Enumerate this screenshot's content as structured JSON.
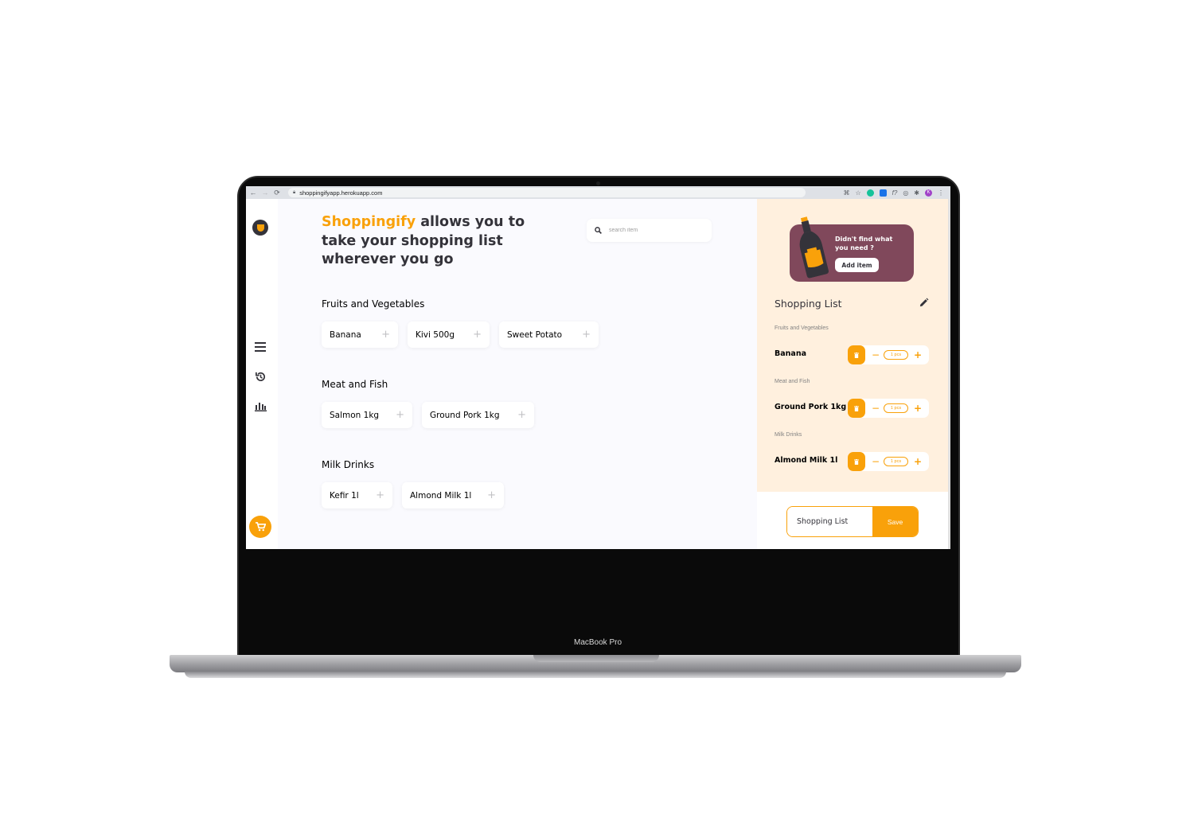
{
  "device": {
    "model_label": "MacBook Pro"
  },
  "browser": {
    "url": "shoppingifyapp.herokuapp.com",
    "profile_initial": "K"
  },
  "hero": {
    "brand": "Shoppingify",
    "tagline": " allows you to take your shopping list wherever you go"
  },
  "search": {
    "placeholder": "search item"
  },
  "categories": [
    {
      "title": "Fruits and Vegetables",
      "items": [
        "Banana",
        "Kivi 500g",
        "Sweet Potato"
      ]
    },
    {
      "title": "Meat and Fish",
      "items": [
        "Salmon 1kg",
        "Ground Pork 1kg"
      ]
    },
    {
      "title": "Milk Drinks",
      "items": [
        "Kefir 1l",
        "Almond Milk 1l"
      ]
    }
  ],
  "promo": {
    "text": "Didn't find what you need ?",
    "button": "Add item"
  },
  "shopping_list": {
    "title": "Shopping List",
    "groups": [
      {
        "category": "Fruits and Vegetables",
        "item": "Banana",
        "qty": "1 pcs"
      },
      {
        "category": "Meat and Fish",
        "item": "Ground Pork 1kg",
        "qty": "1 pcs"
      },
      {
        "category": "Milk Drinks",
        "item": "Almond Milk 1l",
        "qty": "1 pcs"
      }
    ]
  },
  "save_form": {
    "value": "Shopping List",
    "button": "Save"
  },
  "colors": {
    "accent": "#f9a10a",
    "promo_bg": "#80485b",
    "panel_bg": "#fff0de",
    "main_bg": "#fafafe",
    "text_dark": "#34333a"
  },
  "icons": {
    "sidebar": [
      "list-icon",
      "history-icon",
      "statistics-icon"
    ],
    "cart": "cart-icon",
    "logo": "shoppingify-logo",
    "edit": "pencil-icon",
    "delete": "trash-icon"
  }
}
